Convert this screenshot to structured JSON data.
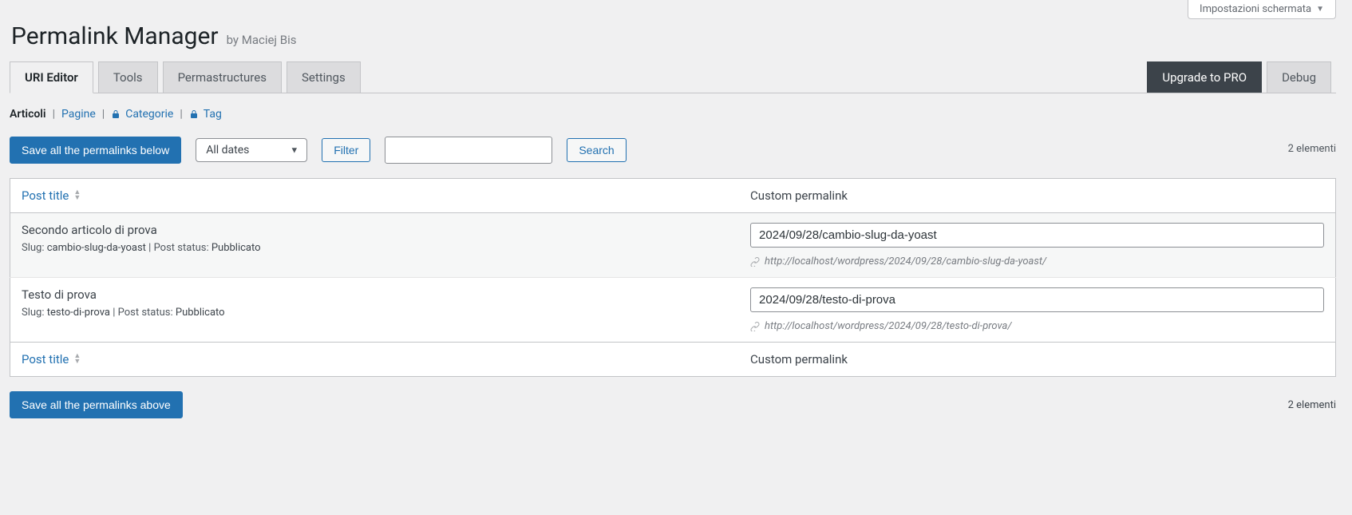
{
  "screen_options": "Impostazioni schermata",
  "title": "Permalink Manager",
  "byline": "by Maciej Bis",
  "tabs": {
    "uri_editor": "URI Editor",
    "tools": "Tools",
    "permastructures": "Permastructures",
    "settings": "Settings",
    "upgrade": "Upgrade to PRO",
    "debug": "Debug"
  },
  "subtabs": {
    "articoli": "Articoli",
    "pagine": "Pagine",
    "categorie": "Categorie",
    "tag": "Tag"
  },
  "buttons": {
    "save_below": "Save all the permalinks below",
    "save_above": "Save all the permalinks above",
    "filter": "Filter",
    "search": "Search"
  },
  "date_filter": {
    "selected": "All dates",
    "options": [
      "All dates"
    ]
  },
  "count_text": "2 elementi",
  "columns": {
    "title": "Post title",
    "permalink": "Custom permalink"
  },
  "labels": {
    "slug": "Slug:",
    "post_status": "Post status:"
  },
  "rows": [
    {
      "title": "Secondo articolo di prova",
      "slug": "cambio-slug-da-yoast",
      "status": "Pubblicato",
      "permalink_value": "2024/09/28/cambio-slug-da-yoast",
      "url": "http://localhost/wordpress/2024/09/28/cambio-slug-da-yoast/"
    },
    {
      "title": "Testo di prova",
      "slug": "testo-di-prova",
      "status": "Pubblicato",
      "permalink_value": "2024/09/28/testo-di-prova",
      "url": "http://localhost/wordpress/2024/09/28/testo-di-prova/"
    }
  ]
}
